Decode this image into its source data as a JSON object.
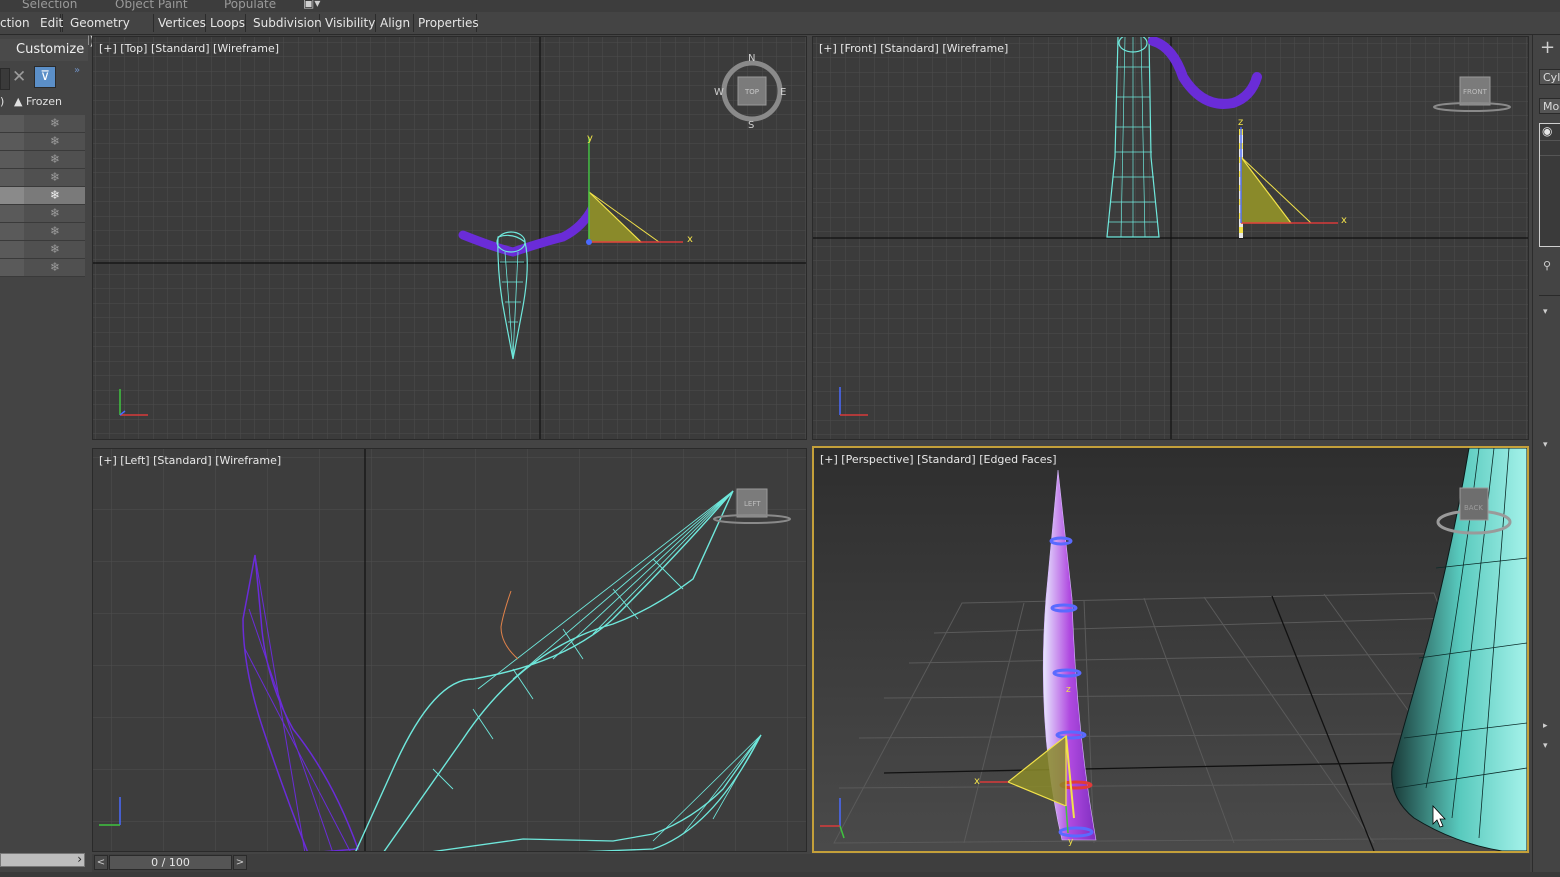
{
  "ribbon_tabs": [
    "Selection",
    "Object Paint",
    "Populate"
  ],
  "menu": [
    "ction",
    "Edit",
    "Geometry (All)",
    "Vertices",
    "Loops",
    "Subdivision",
    "Visibility",
    "Align",
    "Properties"
  ],
  "left_panel": {
    "customize_label": "Customize",
    "column_left": ")",
    "frozen_header": "▲ Frozen",
    "frozen_icon": "❄"
  },
  "viewports": {
    "top": {
      "label": "[+] [Top] [Standard] [Wireframe]",
      "compass": {
        "n": "N",
        "s": "S",
        "e": "E",
        "w": "W",
        "cube": "TOP"
      },
      "axis_x": "x",
      "axis_y": "y"
    },
    "front": {
      "label": "[+] [Front] [Standard] [Wireframe]",
      "cube": "FRONT",
      "axis_x": "x",
      "axis_z": "z"
    },
    "left": {
      "label": "[+] [Left] [Standard] [Wireframe]",
      "cube": "LEFT"
    },
    "perspective": {
      "label": "[+] [Perspective] [Standard] [Edged Faces]",
      "cube": "BACK",
      "axis_x": "x",
      "axis_y": "y",
      "axis_z": "z"
    }
  },
  "right_panel": {
    "cyl_label": "Cyli",
    "mod_label": "Moc"
  },
  "timebar": {
    "prev": "<",
    "frame": "0 / 100",
    "next": ">"
  },
  "colors": {
    "accent_active_viewport": "#c4a03a",
    "cyan_mesh": "#6fe8dc",
    "purple_mesh": "#6a2cd8",
    "light_yellow": "#f2e24a"
  }
}
